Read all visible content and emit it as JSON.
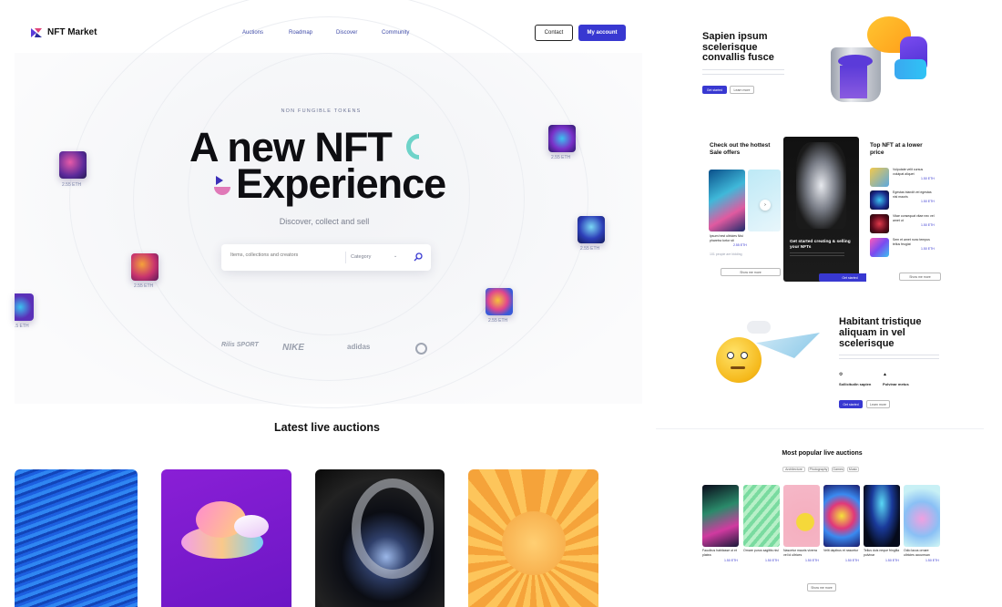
{
  "header": {
    "brand": "NFT Market",
    "nav": [
      "Auctions",
      "Roadmap",
      "Discover",
      "Community"
    ],
    "contact_label": "Contact",
    "account_label": "My account"
  },
  "hero": {
    "eyebrow": "NON FUNGIBLE TOKENS",
    "title_line1": "A new NFT",
    "title_line2": "Experience",
    "subtitle": "Discover, collect and sell",
    "search_placeholder": "Items, collections and creators",
    "category_label": "Category",
    "floating_prices": [
      "2.55 ETH",
      "2.55 ETH",
      "2.55 ETH",
      "2.55 ETH",
      "2.55 ETH",
      "2.55 ETH",
      ".5 ETH"
    ]
  },
  "brands": [
    "Rilis SPORT",
    "NIKE",
    "adidas",
    "Brand"
  ],
  "latest": {
    "title": "Latest live auctions"
  },
  "right": {
    "promo1": {
      "title": "Sapien ipsum scelerisque convallis fusce",
      "get_started": "Get started",
      "learn_more": "Learn more"
    },
    "sale": {
      "title": "Check out the hottest Sale offers",
      "item_title": "Ipsum hest ultricies Nisi pharetra tortor sit",
      "item_price": "2.55 ETH",
      "likes": "101 people are bidding",
      "show_more": "Show me more"
    },
    "center_card": {
      "title": "Get started creating & selling your NFTs",
      "button": "Get started"
    },
    "top_nft": {
      "title": "Top NFT at a lower price",
      "items": [
        {
          "name": "Vulputate velit cursus volutpat aliquet",
          "price": "1.50 ETH",
          "bid": "12.80"
        },
        {
          "name": "Egestas blandit vel egestas nisl mauris",
          "price": "1.50 ETH",
          "bid": "12.80"
        },
        {
          "name": "Vitae consequat vitae nec vel amet ut",
          "price": "1.50 ETH",
          "bid": "12.80"
        },
        {
          "name": "Sem et amet nunc tempus tellus feugiat",
          "price": "1.50 ETH",
          "bid": "12.80"
        }
      ],
      "show_more": "Show me more"
    },
    "promo2": {
      "title": "Habitant tristique aliquam in vel scelerisque",
      "feature1": "Sollicitudin sapien",
      "feature2": "Pulvinar metus",
      "get_started": "Get started",
      "learn_more": "Learn more"
    },
    "popular": {
      "title": "Most popular live auctions",
      "filters": [
        "Architecture",
        "Photography",
        "Games",
        "Music"
      ],
      "items": [
        {
          "name": "Faucibus habitasse ut et platea",
          "price": "1.50 ETH"
        },
        {
          "name": "Ornare purus sagittis nisl",
          "price": "1.50 ETH"
        },
        {
          "name": "Nascetur mauris viverra vel id ultrices",
          "price": "1.50 ETH"
        },
        {
          "name": "Velit dapibus et nascetur",
          "price": "1.50 ETH"
        },
        {
          "name": "Tellus duis neque fringilla pulvinar",
          "price": "1.50 ETH"
        },
        {
          "name": "Odio lacus ornare ultricies accumsan",
          "price": "1.50 ETH"
        }
      ],
      "show_more": "Show me more"
    }
  },
  "colors": {
    "accent": "#3838d1",
    "text": "#111111",
    "muted": "#7a7f8e"
  }
}
